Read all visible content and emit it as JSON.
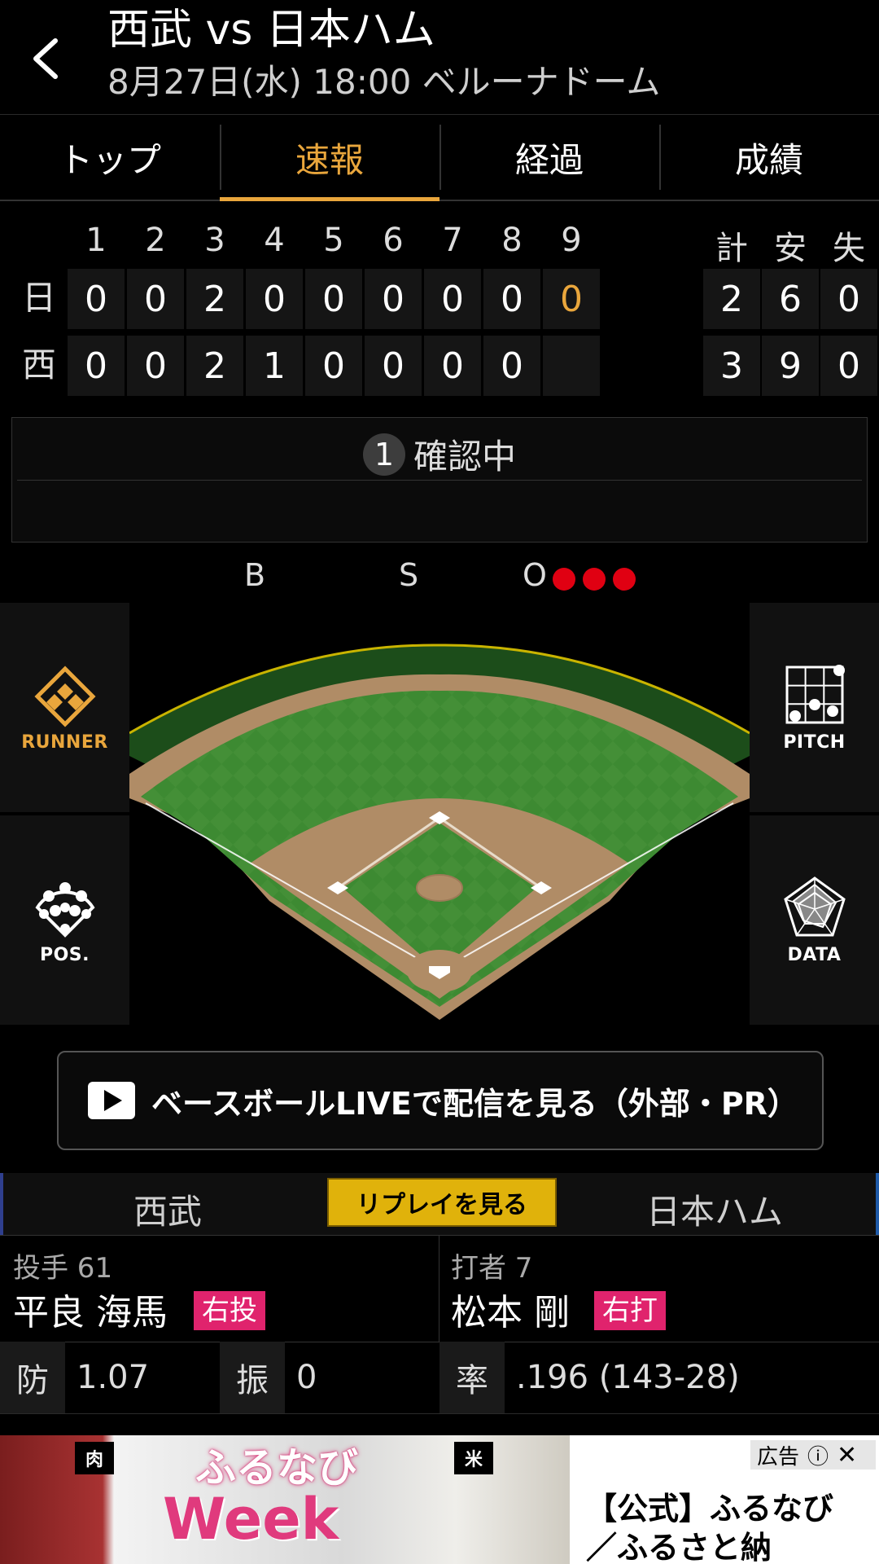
{
  "header": {
    "title": "西武 vs 日本ハム",
    "subtitle": "8月27日(水) 18:00 ベルーナドーム"
  },
  "tabs": [
    {
      "label": "トップ"
    },
    {
      "label": "速報",
      "active": true
    },
    {
      "label": "経過"
    },
    {
      "label": "成績"
    }
  ],
  "scoreboard": {
    "innings": [
      "1",
      "2",
      "3",
      "4",
      "5",
      "6",
      "7",
      "8",
      "9"
    ],
    "totals_headers": [
      "計",
      "安",
      "失"
    ],
    "teams": [
      {
        "abbr": "日",
        "scores": [
          "0",
          "0",
          "2",
          "0",
          "0",
          "0",
          "0",
          "0",
          "0"
        ],
        "totals": [
          "2",
          "6",
          "0"
        ]
      },
      {
        "abbr": "西",
        "scores": [
          "0",
          "0",
          "2",
          "1",
          "0",
          "0",
          "0",
          "0",
          ""
        ],
        "totals": [
          "3",
          "9",
          "0"
        ]
      }
    ]
  },
  "play": {
    "badge": "1",
    "status": "確認中"
  },
  "count": {
    "b_label": "B",
    "s_label": "S",
    "o_label": "O",
    "balls": 0,
    "strikes": 0,
    "outs": 3,
    "out_color": "#e00012"
  },
  "side_buttons": {
    "runner": "RUNNER",
    "pos": "POS.",
    "pitch": "PITCH",
    "data": "DATA"
  },
  "live": {
    "label": "ベースボールLIVEで配信を見る（外部・PR）"
  },
  "matchup": {
    "home": "西武",
    "replay": "リプレイを見る",
    "away": "日本ハム"
  },
  "pitcher": {
    "role": "投手 61",
    "name": "平良 海馬",
    "hand": "右投",
    "era_label": "防",
    "era": "1.07",
    "k_label": "振",
    "k": "0"
  },
  "batter": {
    "role": "打者 7",
    "name": "松本 剛",
    "hand": "右打",
    "avg_label": "率",
    "avg": ".196 (143-28)"
  },
  "ad": {
    "tag": "広告",
    "cat1": "肉",
    "cat2": "米",
    "logo": "ふるなび",
    "week": "Week",
    "text": "【公式】ふるなび／ふるさと納"
  },
  "colors": {
    "accent": "#e9a63c",
    "badge_pink": "#e0236d",
    "replay_yellow": "#e0b20b"
  }
}
